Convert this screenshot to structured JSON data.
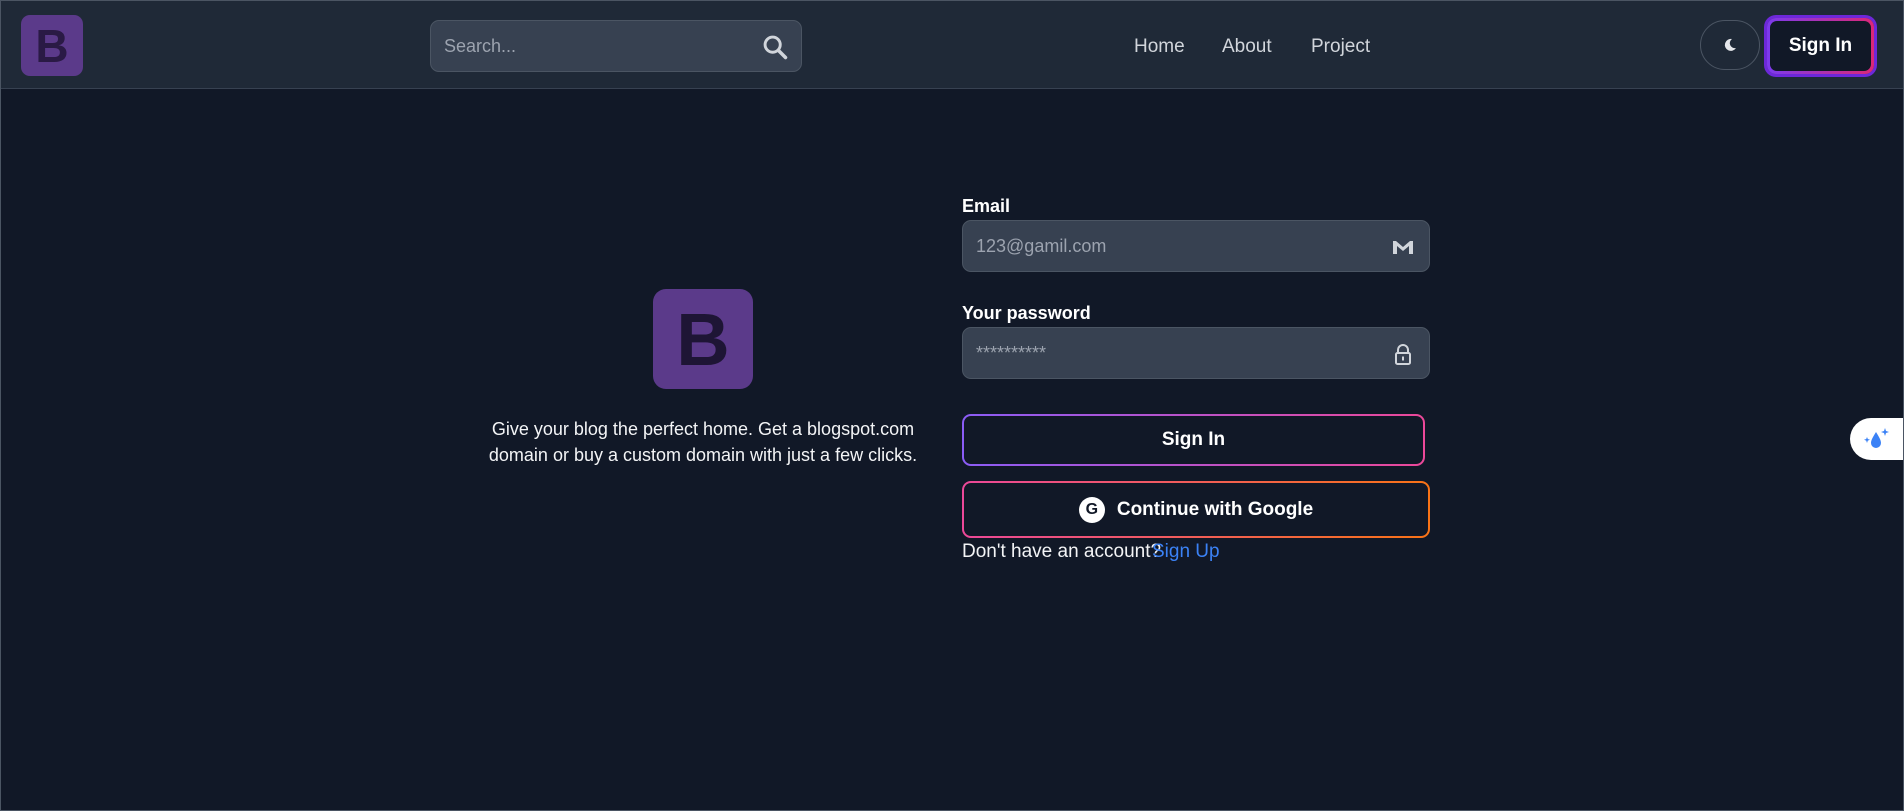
{
  "header": {
    "logo_letter": "B",
    "search": {
      "placeholder": "Search..."
    },
    "nav": [
      {
        "label": "Home"
      },
      {
        "label": "About"
      },
      {
        "label": "Project"
      }
    ],
    "theme_toggle_icon": "moon-icon",
    "sign_in_label": "Sign In"
  },
  "hero": {
    "logo_letter": "B",
    "tagline": "Give your blog the perfect home. Get a blogspot.com domain or buy a custom domain with just a few clicks."
  },
  "form": {
    "email_label": "Email",
    "email_placeholder": "123@gamil.com",
    "email_icon": "gmail-icon",
    "password_label": "Your password",
    "password_placeholder": "**********",
    "password_icon": "lock-icon",
    "sign_in_label": "Sign In",
    "google_label": "Continue with Google",
    "google_icon": "google-icon",
    "no_account_text": "Don't have an account?",
    "sign_up_label": "Sign Up"
  },
  "colors": {
    "background": "#111827",
    "navbar": "#1f2937",
    "input_bg": "#374151",
    "logo": "#5b3a8a",
    "link": "#3b82f6",
    "gradient_purple": "#8b5cf6",
    "gradient_pink": "#ec4899",
    "gradient_orange": "#f97316"
  }
}
